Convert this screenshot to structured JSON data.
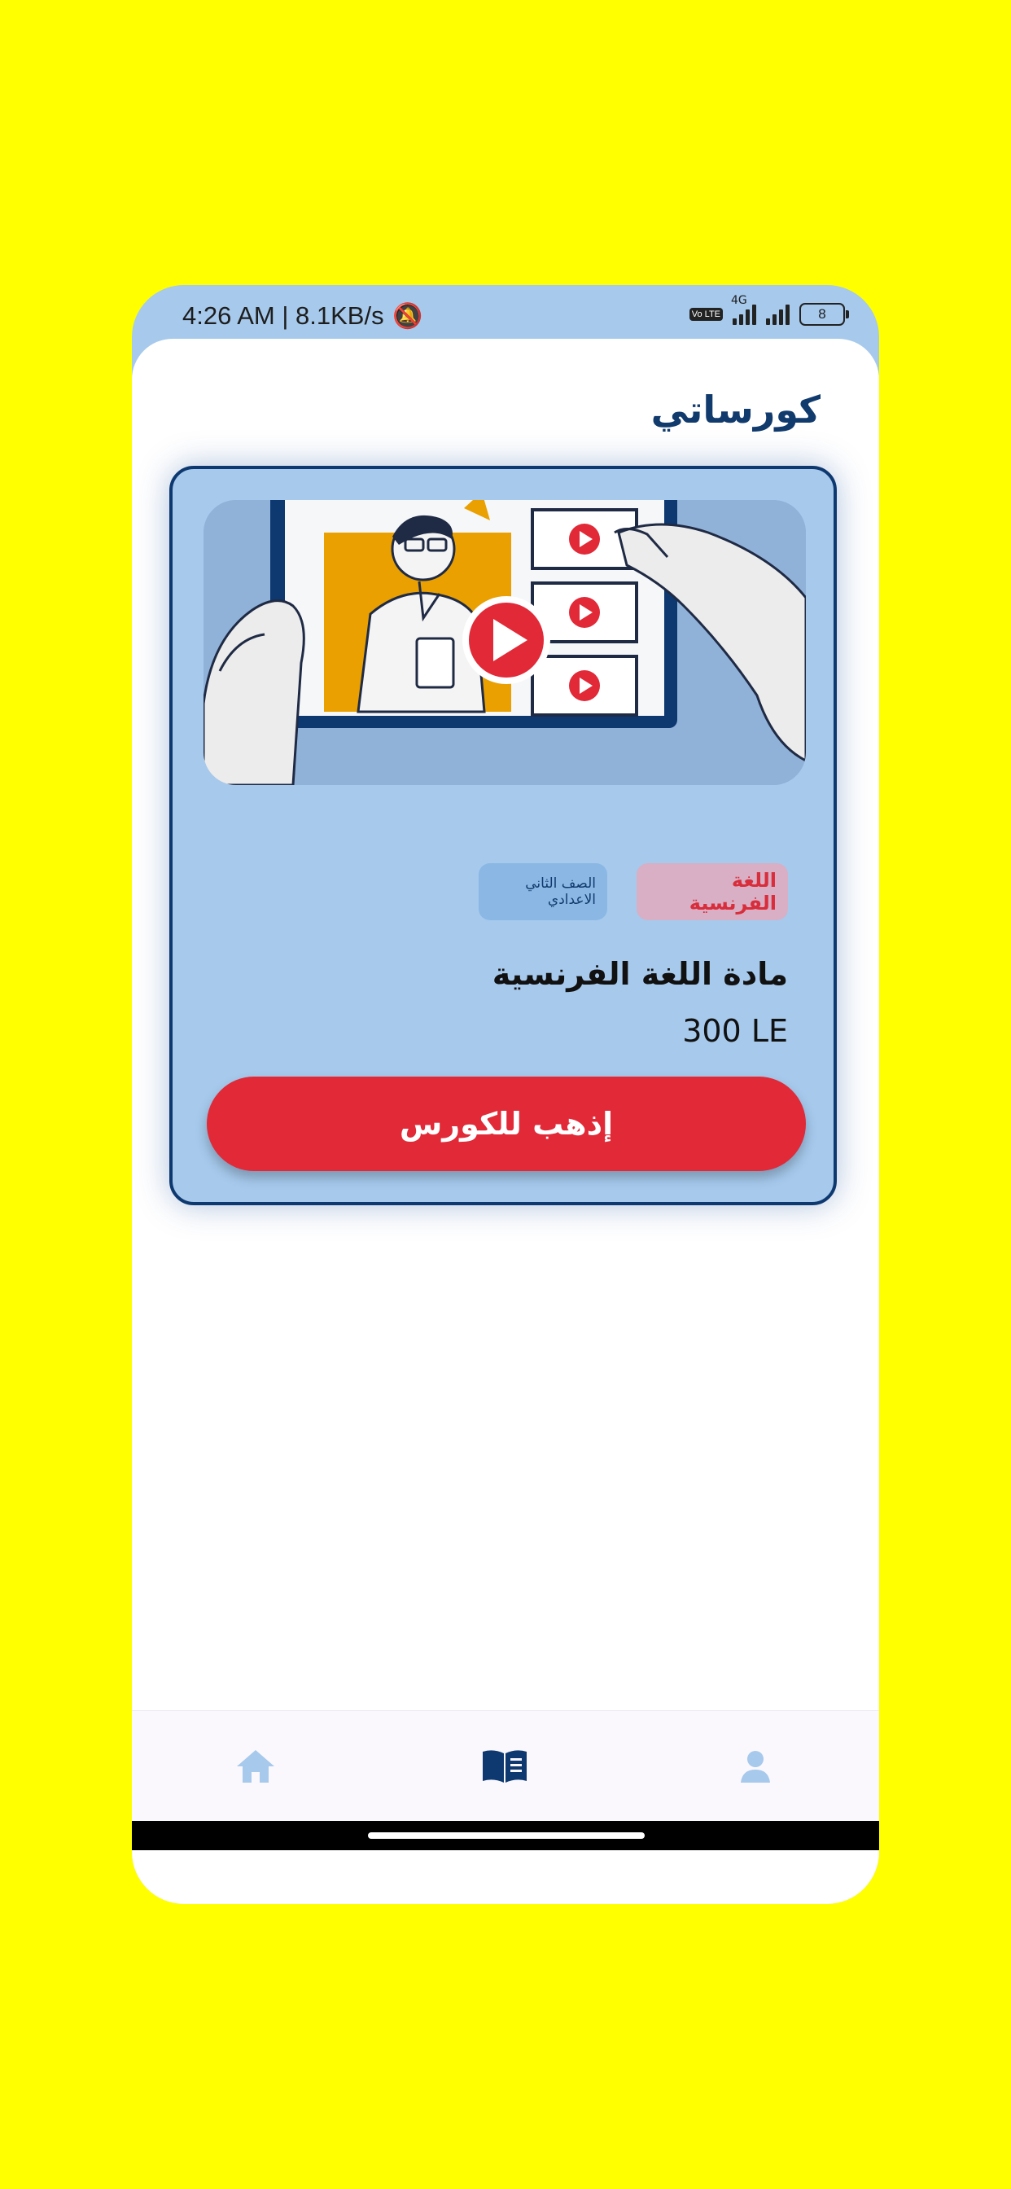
{
  "status_bar": {
    "time": "4:26 AM",
    "separator": " | ",
    "net_speed": "8.1KB/s",
    "volte_label": "Vo LTE",
    "network_type": "4G",
    "battery_level": "8"
  },
  "header": {
    "title": "كورساتي"
  },
  "course_card": {
    "thumbnail_icon": "video-lesson-illustration",
    "badges": {
      "grade": "الصف الثاني الاعدادي",
      "subject": "اللغة الفرنسية"
    },
    "title": "مادة اللغة الفرنسية",
    "price": "300 LE",
    "go_button": "إذهب للكورس"
  },
  "bottom_nav": {
    "items": [
      {
        "icon": "home-icon",
        "active": false
      },
      {
        "icon": "book-icon",
        "active": true
      },
      {
        "icon": "person-icon",
        "active": false
      }
    ]
  },
  "colors": {
    "background": "#FFFF00",
    "primary": "#0E3970",
    "card": "#A6C9EC",
    "accent_red": "#E12937",
    "nav_inactive": "#A6C9EC"
  }
}
